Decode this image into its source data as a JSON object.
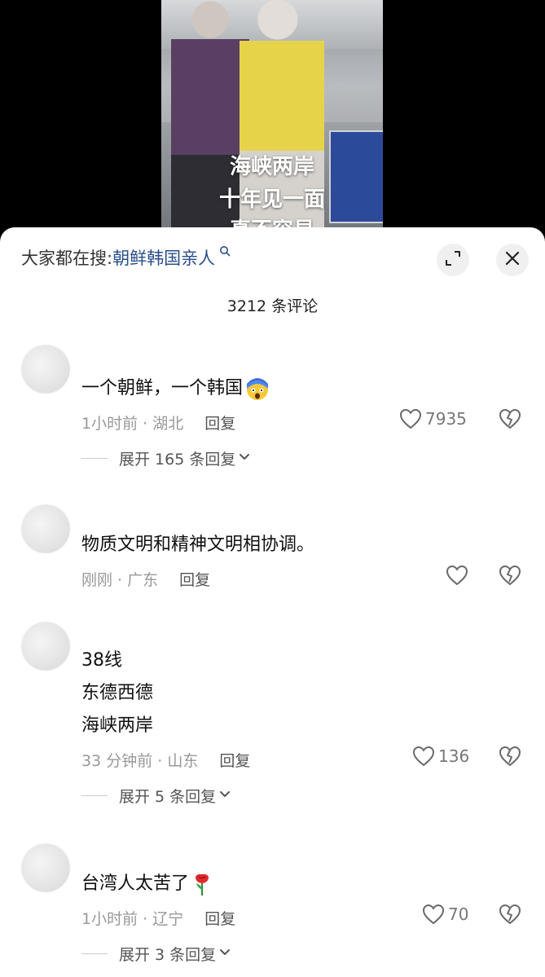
{
  "video": {
    "overlay_lines": [
      "海峡两岸",
      "十年见一面",
      "真不容易"
    ]
  },
  "search": {
    "prefix": "大家都在搜:",
    "link": "朝鲜韩国亲人"
  },
  "header": {
    "title": "3212 条评论"
  },
  "comments": [
    {
      "text": "一个朝鲜，一个韩国",
      "time_loc": "1小时前 · 湖北",
      "reply": "回复",
      "likes": "7935",
      "expand": "展开 165 条回复"
    },
    {
      "text": "物质文明和精神文明相协调。",
      "time_loc": "刚刚 · 广东",
      "reply": "回复",
      "likes": "",
      "expand": ""
    },
    {
      "lines": [
        "38线",
        "东德西德",
        "海峡两岸"
      ],
      "time_loc": "33 分钟前 · 山东",
      "reply": "回复",
      "likes": "136",
      "expand": "展开 5 条回复"
    },
    {
      "text": "台湾人太苦了",
      "time_loc": "1小时前 · 辽宁",
      "reply": "回复",
      "likes": "70",
      "expand": "展开 3 条回复"
    }
  ],
  "icons": {
    "expand": "expand-icon",
    "close": "close-icon",
    "search": "search-icon",
    "like": "heart-icon",
    "dislike": "broken-heart-icon"
  }
}
